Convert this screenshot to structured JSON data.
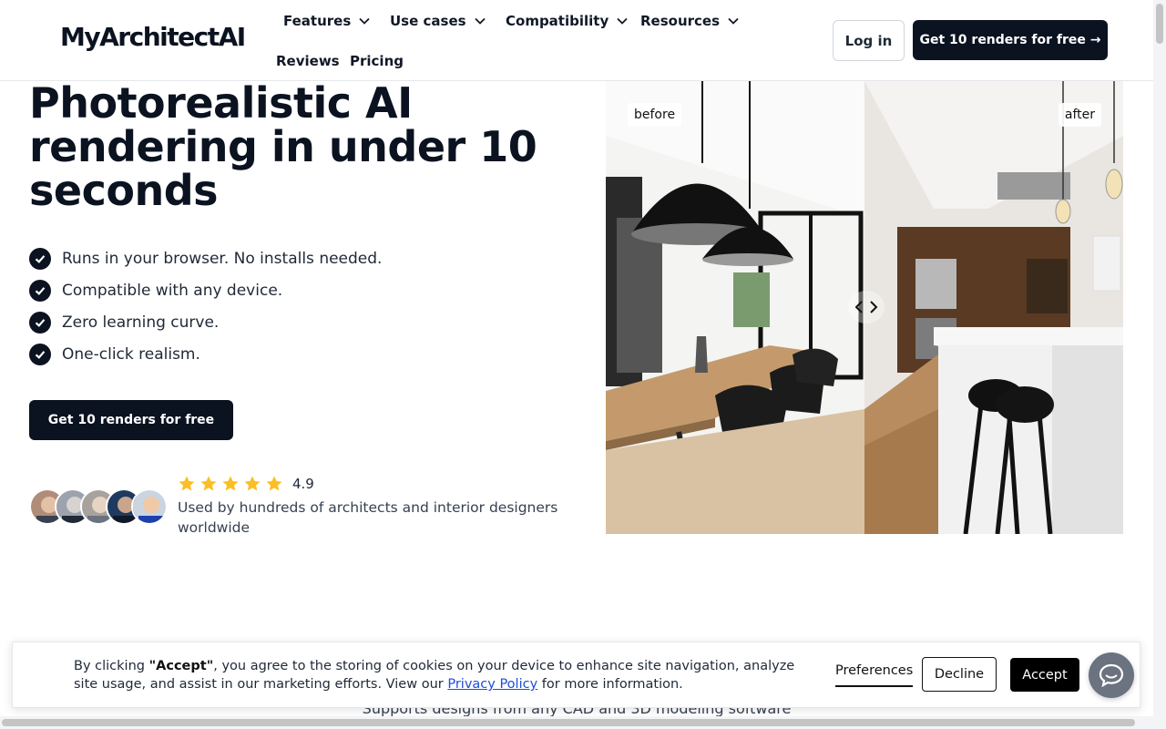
{
  "brand": {
    "name": "MyArchitectAI"
  },
  "nav": {
    "items": [
      {
        "label": "Features",
        "dropdown": true
      },
      {
        "label": "Use cases",
        "dropdown": true
      },
      {
        "label": "Compatibility",
        "dropdown": true
      },
      {
        "label": "Resources",
        "dropdown": true
      },
      {
        "label": "Reviews",
        "dropdown": false
      },
      {
        "label": "Pricing",
        "dropdown": false
      }
    ],
    "login_label": "Log in",
    "cta_label": "Get 10 renders for free →"
  },
  "hero": {
    "title": "Photorealistic AI rendering in under 10 seconds",
    "features": [
      "Runs in your browser. No installs needed.",
      "Compatible with any device.",
      "Zero learning curve.",
      "One-click realism."
    ],
    "cta_label": "Get 10 renders for free",
    "rating": {
      "stars": 5,
      "value": "4.9"
    },
    "social_proof": "Used by hundreds of architects and interior designers worldwide"
  },
  "compare": {
    "before_label": "before",
    "after_label": "after",
    "split": 0.5
  },
  "next_section": {
    "subtitle": "Supports designs from any CAD and 3D modeling software"
  },
  "cookie": {
    "text_prefix": "By clicking ",
    "text_bold": "\"Accept\"",
    "text_middle": ", you agree to the storing of cookies on your device to enhance site navigation, analyze site usage, and assist in our marketing efforts. View our ",
    "link_label": "Privacy Policy",
    "text_suffix": " for more information.",
    "preferences_label": "Preferences",
    "decline_label": "Decline",
    "accept_label": "Accept"
  },
  "colors": {
    "primary": "#0b1220",
    "star": "#fbbf24",
    "link": "#1d4ed8"
  },
  "icons": {
    "chevron": "chevron-down-icon",
    "check": "check-circle-icon",
    "star": "star-icon",
    "chat": "chat-bubble-icon"
  }
}
